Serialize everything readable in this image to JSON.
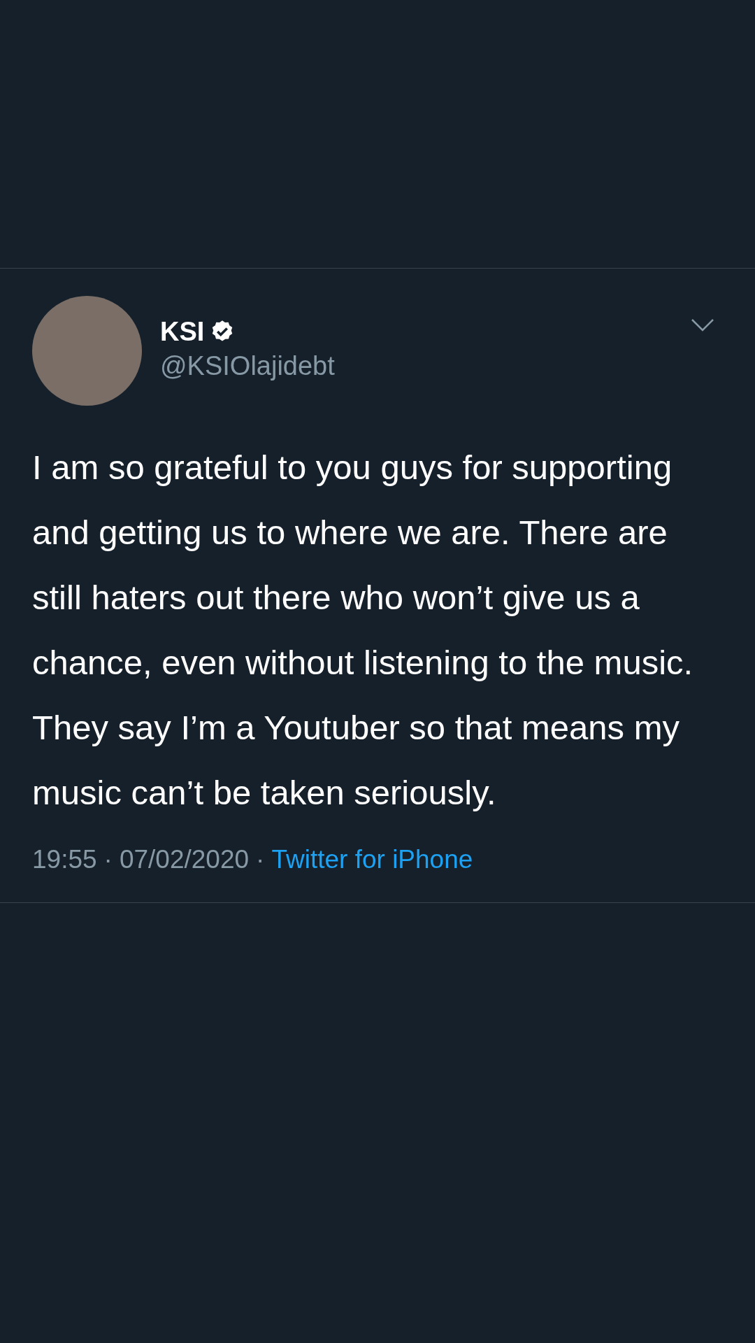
{
  "tweet": {
    "author": {
      "name": "KSI",
      "verified": true,
      "handle": "@KSIOlajidebt"
    },
    "text": "I am so grateful to you guys for supporting and getting us to where we are. There are still haters out there who won’t give us a chance, even without listening to the music. They say I’m a Youtuber so that means my music can’t be taken seriously.",
    "time": "19:55",
    "date": "07/02/2020",
    "separator": "·",
    "source": "Twitter for iPhone"
  }
}
